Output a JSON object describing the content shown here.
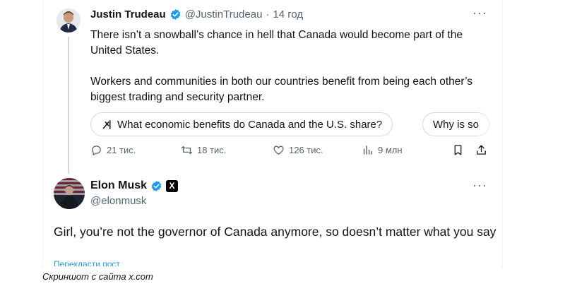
{
  "tweet1": {
    "display_name": "Justin Trudeau",
    "handle": "@JustinTrudeau",
    "separator": "·",
    "time": "14 год",
    "more": "···",
    "text_p1": "There isn’t a snowball’s chance in hell that Canada would become part of the United States.",
    "text_p2": "Workers and communities in both our countries benefit from being each other’s biggest trading and security partner.",
    "grok_chips": [
      "What economic benefits do Canada and the U.S. share?",
      "Why is so"
    ],
    "actions": {
      "replies": "21 тис.",
      "reposts": "18 тис.",
      "likes": "126 тис.",
      "views": "9 млн"
    }
  },
  "tweet2": {
    "display_name": "Elon Musk",
    "handle": "@elonmusk",
    "affiliation_badge": "X",
    "more": "···",
    "text": "Girl, you’re not the governor of Canada anymore, so doesn’t matter what you say",
    "translate_link": "Перекласти пост"
  },
  "caption": "Скриншот с сайта x.com",
  "colors": {
    "verified_blue": "#1d9bf0",
    "secondary_text": "#536471",
    "primary_text": "#0f1419",
    "border": "#cfd9de"
  },
  "icons": [
    "verified-icon",
    "grok-icon",
    "reply-icon",
    "repost-icon",
    "like-icon",
    "views-icon",
    "bookmark-icon",
    "share-icon",
    "x-badge-icon",
    "more-icon"
  ]
}
